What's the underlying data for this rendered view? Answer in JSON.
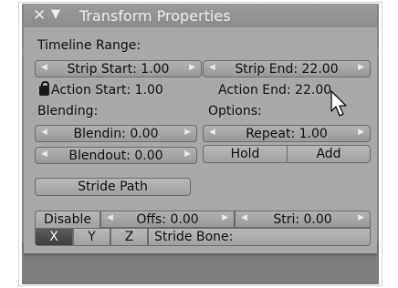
{
  "header": {
    "close_glyph": "✕",
    "collapse_glyph": "▼",
    "title": "Transform Properties"
  },
  "timeline": {
    "section_label": "Timeline Range:",
    "strip_start": "Strip Start: 1.00",
    "strip_end": "Strip End: 22.00",
    "action_start": "Action Start: 1.00",
    "action_end": "Action End: 22.00"
  },
  "blending": {
    "section_label": "Blending:",
    "blendin": "Blendin: 0.00",
    "blendout": "Blendout: 0.00"
  },
  "options": {
    "section_label": "Options:",
    "repeat": "Repeat: 1.00",
    "hold_label": "Hold",
    "add_label": "Add"
  },
  "stride": {
    "path_label": "Stride Path",
    "disable_label": "Disable",
    "offs": "Offs: 0.00",
    "stri": "Stri: 0.00",
    "axis_x": "X",
    "axis_y": "Y",
    "axis_z": "Z",
    "bone_label": "Stride Bone:",
    "bone_value": ""
  },
  "colors": {
    "panel_bg": "#a9a9a9",
    "selected_button": "#4a4a4a"
  }
}
